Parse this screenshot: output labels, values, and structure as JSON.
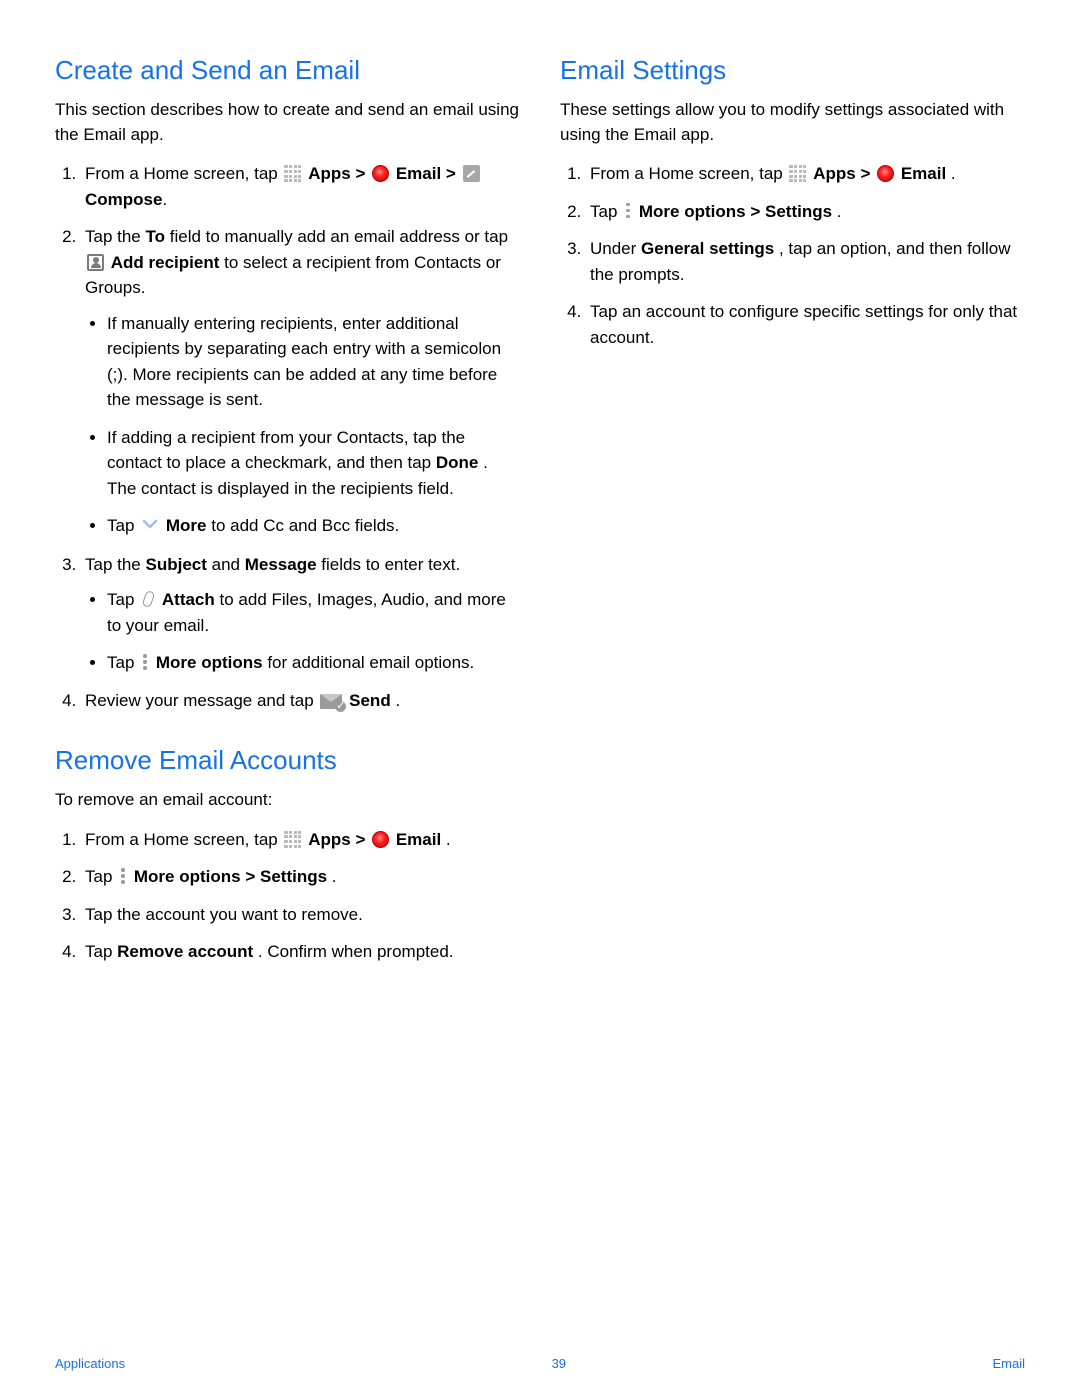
{
  "left": {
    "section1": {
      "heading": "Create and Send an Email",
      "intro": "This section describes how to create and send an email using the Email app.",
      "step1_a": "From a Home screen, tap ",
      "apps": "Apps",
      "gt": " > ",
      "email_b": "Email",
      "compose_b": "Compose",
      "step2_a": "Tap the ",
      "to_b": "To",
      "step2_b": " field to manually add an email address or tap ",
      "addrec_b": "Add recipient",
      "step2_c": " to select a recipient from Contacts or Groups.",
      "bullet1": "If manually entering recipients, enter additional recipients by separating each entry with a semicolon (;). More recipients can be added at any time before the message is sent.",
      "bullet2_a": "If adding a recipient from your Contacts, tap the contact to place a checkmark, and then tap ",
      "done_b": "Done",
      "bullet2_b": ". The contact is displayed in the recipients field.",
      "bullet3_a": "Tap ",
      "more_b": "More",
      "bullet3_b": " to add Cc and Bcc fields.",
      "step3_a": "Tap the ",
      "subject_b": "Subject",
      "and": " and ",
      "message_b": "Message",
      "step3_b": " fields to enter text.",
      "bullet4_a": "Tap ",
      "attach_b": "Attach",
      "bullet4_b": " to add Files, Images, Audio, and more to your email.",
      "bullet5_a": "Tap ",
      "moreopt_b": "More options",
      "bullet5_b": " for additional email options.",
      "step4_a": "Review your message and tap ",
      "send_b": "Send",
      "period": "."
    },
    "section2": {
      "heading": "Remove Email Accounts",
      "intro": "To remove an email account:",
      "step1_a": "From a Home screen, tap ",
      "apps": "Apps",
      "gt": " > ",
      "email_b": "Email",
      "period": ".",
      "step2_a": "Tap ",
      "moreopt_b": "More options",
      "step2_gt": " > ",
      "settings_b": "Settings",
      "step3": "Tap the account you want to remove.",
      "step4_a": "Tap ",
      "removeacc_b": "Remove account",
      "step4_b": ". Confirm when prompted."
    }
  },
  "right": {
    "heading": "Email Settings",
    "intro": "These settings allow you to modify settings associated with using the Email app.",
    "step1_a": "From a Home screen, tap ",
    "apps": "Apps",
    "gt": " > ",
    "email_b": "Email",
    "period": ".",
    "step2_a": "Tap ",
    "moreopt_b": "More options",
    "step2_gt": " > ",
    "settings_b": "Settings",
    "step3_a": "Under ",
    "gensettings_b": "General settings",
    "step3_b": ", tap an option, and then follow the prompts.",
    "step4": "Tap an account to configure specific settings for only that account."
  },
  "footer": {
    "left": "Applications",
    "page": "39",
    "right": "Email"
  }
}
